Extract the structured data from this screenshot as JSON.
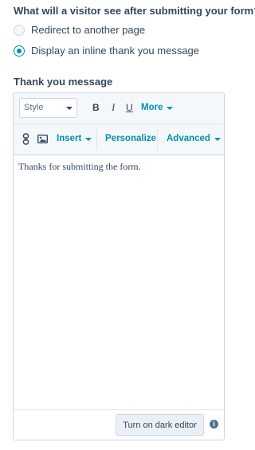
{
  "form": {
    "question": "What will a visitor see after submitting your form?",
    "options": [
      {
        "label": "Redirect to another page",
        "selected": false
      },
      {
        "label": "Display an inline thank you message",
        "selected": true
      }
    ]
  },
  "thank_you": {
    "label": "Thank you message",
    "toolbar": {
      "style_label": "Style",
      "bold": "B",
      "italic": "I",
      "underline": "U",
      "more": "More",
      "link_icon": "link-icon",
      "image_icon": "image-icon",
      "insert": "Insert",
      "personalize": "Personalize",
      "advanced": "Advanced"
    },
    "content": "Thanks for submitting the form.",
    "footer": {
      "dark_editor_button": "Turn on dark editor",
      "info_glyph": "i"
    }
  },
  "colors": {
    "accent": "#0091ae",
    "text": "#33475b",
    "border": "#cbd6e2",
    "toolbar_bg": "#f5f8fa"
  }
}
